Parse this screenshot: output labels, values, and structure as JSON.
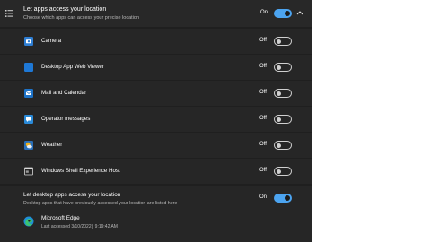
{
  "header": {
    "title": "Let apps access your location",
    "subtitle": "Choose which apps can access your precise location",
    "state": "On",
    "toggle_on": true,
    "icon": "list-settings-icon"
  },
  "apps": [
    {
      "name": "Camera",
      "state": "Off",
      "icon": "camera-icon",
      "color": "#2d7dd2"
    },
    {
      "name": "Desktop App Web Viewer",
      "state": "Off",
      "icon": "web-viewer-icon",
      "color": "#1e78d6"
    },
    {
      "name": "Mail and Calendar",
      "state": "Off",
      "icon": "mail-icon",
      "color": "#1e73c8"
    },
    {
      "name": "Operator messages",
      "state": "Off",
      "icon": "message-icon",
      "color": "#2a8ad8"
    },
    {
      "name": "Weather",
      "state": "Off",
      "icon": "weather-icon",
      "color": "#f2b21c"
    },
    {
      "name": "Windows Shell Experience Host",
      "state": "Off",
      "icon": "window-icon",
      "color": "#5a5a5a"
    }
  ],
  "desktop": {
    "title": "Let desktop apps access your location",
    "subtitle": "Desktop apps that have previously accessed your location are listed here",
    "state": "On",
    "toggle_on": true,
    "app_name": "Microsoft Edge",
    "last_accessed": "Last accessed 3/10/2022 | 9:19:42 AM",
    "app_icon": "edge-icon"
  },
  "colors": {
    "background": "#1f1f1f",
    "row": "#262626",
    "accent": "#4ca4f0"
  }
}
